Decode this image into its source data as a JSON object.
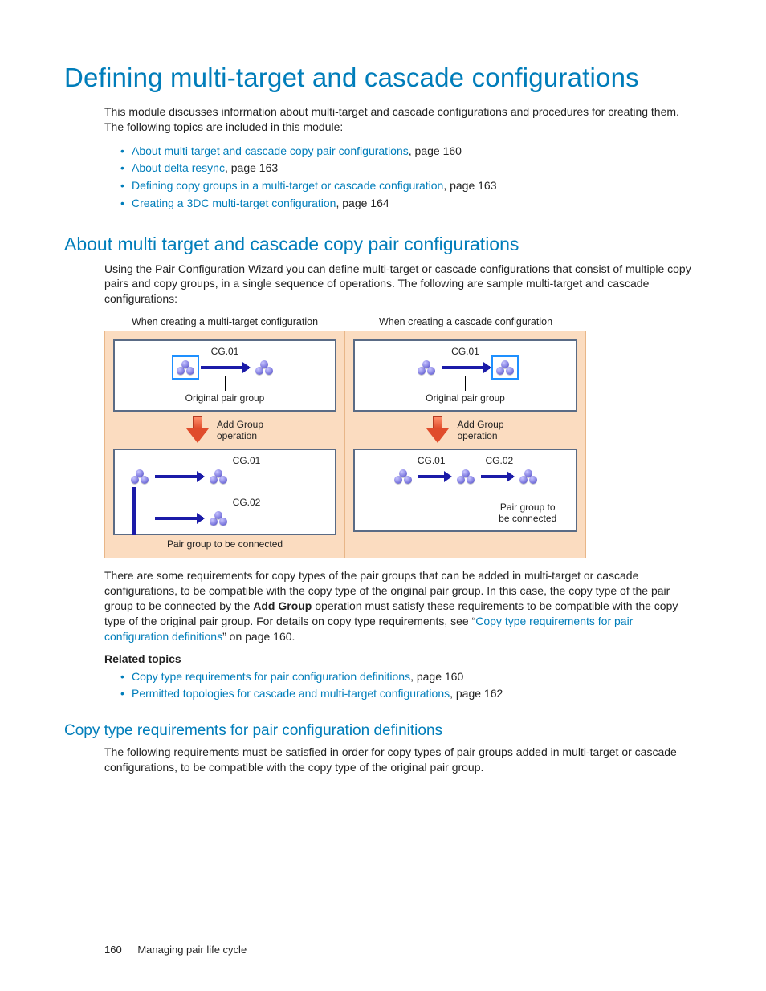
{
  "title": "Defining multi-target and cascade configurations",
  "intro": "This module discusses information about multi-target and cascade configurations and procedures for creating them. The following topics are included in this module:",
  "toc": [
    {
      "link": "About multi target and cascade copy pair configurations",
      "suffix": ", page 160"
    },
    {
      "link": "About delta resync",
      "suffix": ", page 163"
    },
    {
      "link": "Defining copy groups in a multi-target or cascade configuration",
      "suffix": ", page 163"
    },
    {
      "link": "Creating a 3DC multi-target configuration",
      "suffix": ", page 164"
    }
  ],
  "sec1": {
    "heading": "About multi target and cascade copy pair configurations",
    "p1": "Using the Pair Configuration Wizard you can define multi-target or cascade configurations that consist of multiple copy pairs and copy groups, in a single sequence of operations. The following are sample multi-target and cascade configurations:",
    "fig": {
      "cap_left": "When creating a multi-target configuration",
      "cap_right": "When creating a cascade configuration",
      "cg01": "CG.01",
      "cg02": "CG.02",
      "orig": "Original pair group",
      "addop": "Add Group\noperation",
      "conn_left": "Pair group to be connected",
      "conn_right": "Pair group to\nbe connected"
    },
    "p2a": "There are some requirements for copy types of  the pair groups that can be added in multi-target or cascade configurations, to be compatible with the copy type of the original pair group. In this case, the copy type of the pair group to be connected by the ",
    "p2_bold": "Add Group",
    "p2b": " operation must satisfy these requirements to be compatible with the copy type of the original pair group. For details on copy type requirements, see “",
    "p2_link": "Copy type requirements for pair configuration definitions",
    "p2c": "” on page 160.",
    "related_heading": "Related topics",
    "related": [
      {
        "link": "Copy type requirements for pair configuration definitions",
        "suffix": ", page 160"
      },
      {
        "link": "Permitted topologies for cascade and multi-target configurations",
        "suffix": ", page 162"
      }
    ]
  },
  "sec2": {
    "heading": "Copy type requirements for pair configuration definitions",
    "p1": "The following requirements must be satisfied in order for copy types of pair groups added in multi-target or cascade configurations, to be compatible with the copy type of the original pair group."
  },
  "footer": {
    "page": "160",
    "chapter": "Managing pair life cycle"
  }
}
